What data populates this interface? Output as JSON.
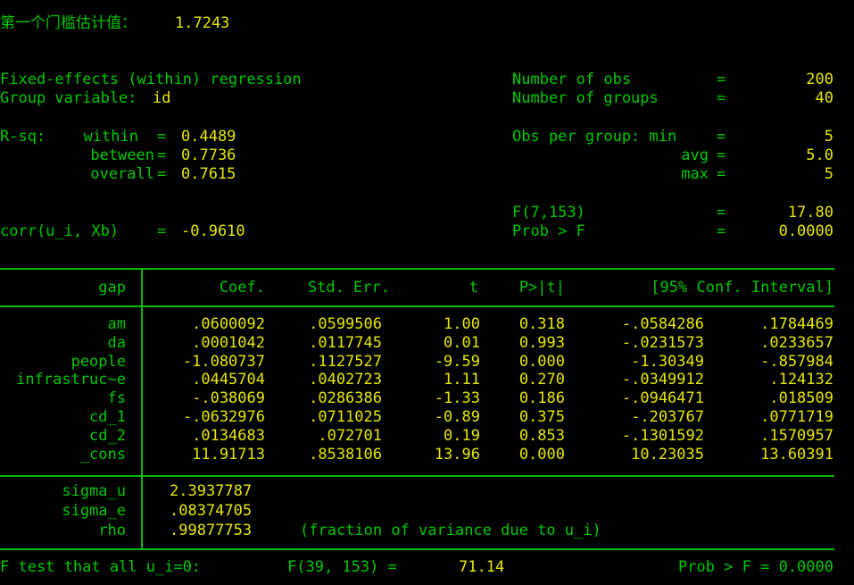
{
  "header": {
    "threshold_label": "第一个门槛估计值：",
    "threshold_value": "1.7243"
  },
  "model": {
    "title": "Fixed-effects (within) regression",
    "group_var_label": "Group variable:",
    "group_var_value": "id",
    "nobs_label": "Number of obs",
    "nobs_value": "200",
    "ngroups_label": "Number of groups",
    "ngroups_value": "40",
    "eq": "=",
    "rsq_label": "R-sq:",
    "within_label": "within",
    "within_value": "0.4489",
    "between_label": "between",
    "between_value": "0.7736",
    "overall_label": "overall",
    "overall_value": "0.7615",
    "obs_per_group_label": "Obs per group: min",
    "min_value": "5",
    "avg_label": "avg",
    "avg_value": "5.0",
    "max_label": "max",
    "max_value": "5",
    "f_label": "F(7,153)",
    "f_value": "17.80",
    "corr_label": "corr(u_i, Xb)",
    "corr_value": "-0.9610",
    "probf_label": "Prob > F",
    "probf_value": "0.0000"
  },
  "table": {
    "headers": [
      "gap",
      "Coef.",
      "Std. Err.",
      "t",
      "P>|t|",
      "[95% Conf. Interval]"
    ],
    "rows": [
      [
        "am",
        ".0600092",
        ".0599506",
        "1.00",
        "0.318",
        "-.0584286",
        ".1784469"
      ],
      [
        "da",
        ".0001042",
        ".0117745",
        "0.01",
        "0.993",
        "-.0231573",
        ".0233657"
      ],
      [
        "people",
        "-1.080737",
        ".1127527",
        "-9.59",
        "0.000",
        "-1.30349",
        "-.857984"
      ],
      [
        "infrastruc~e",
        ".0445704",
        ".0402723",
        "1.11",
        "0.270",
        "-.0349912",
        ".124132"
      ],
      [
        "fs",
        "-.038069",
        ".0286386",
        "-1.33",
        "0.186",
        "-.0946471",
        ".018509"
      ],
      [
        "cd_1",
        "-.0632976",
        ".0711025",
        "-0.89",
        "0.375",
        "-.203767",
        ".0771719"
      ],
      [
        "cd_2",
        ".0134683",
        ".072701",
        "0.19",
        "0.853",
        "-.1301592",
        ".1570957"
      ],
      [
        "_cons",
        "11.91713",
        ".8538106",
        "13.96",
        "0.000",
        "10.23035",
        "13.60391"
      ]
    ],
    "sigma_u_label": "sigma_u",
    "sigma_u_value": "2.3937787",
    "sigma_e_label": "sigma_e",
    "sigma_e_value": ".08374705",
    "rho_label": "rho",
    "rho_value": ".99877753",
    "rho_note": "(fraction of variance due to u_i)"
  },
  "ftest": {
    "label": "F test that all u_i=0:",
    "stat_label": "F(39, 153) =",
    "stat_value": "71.14",
    "prob_text": "Prob > F = 0.0000"
  },
  "colors": {
    "background": "#000000",
    "label_green": "#00c800",
    "value_yellow": "#e6e600",
    "rule_green": "#00b800"
  }
}
